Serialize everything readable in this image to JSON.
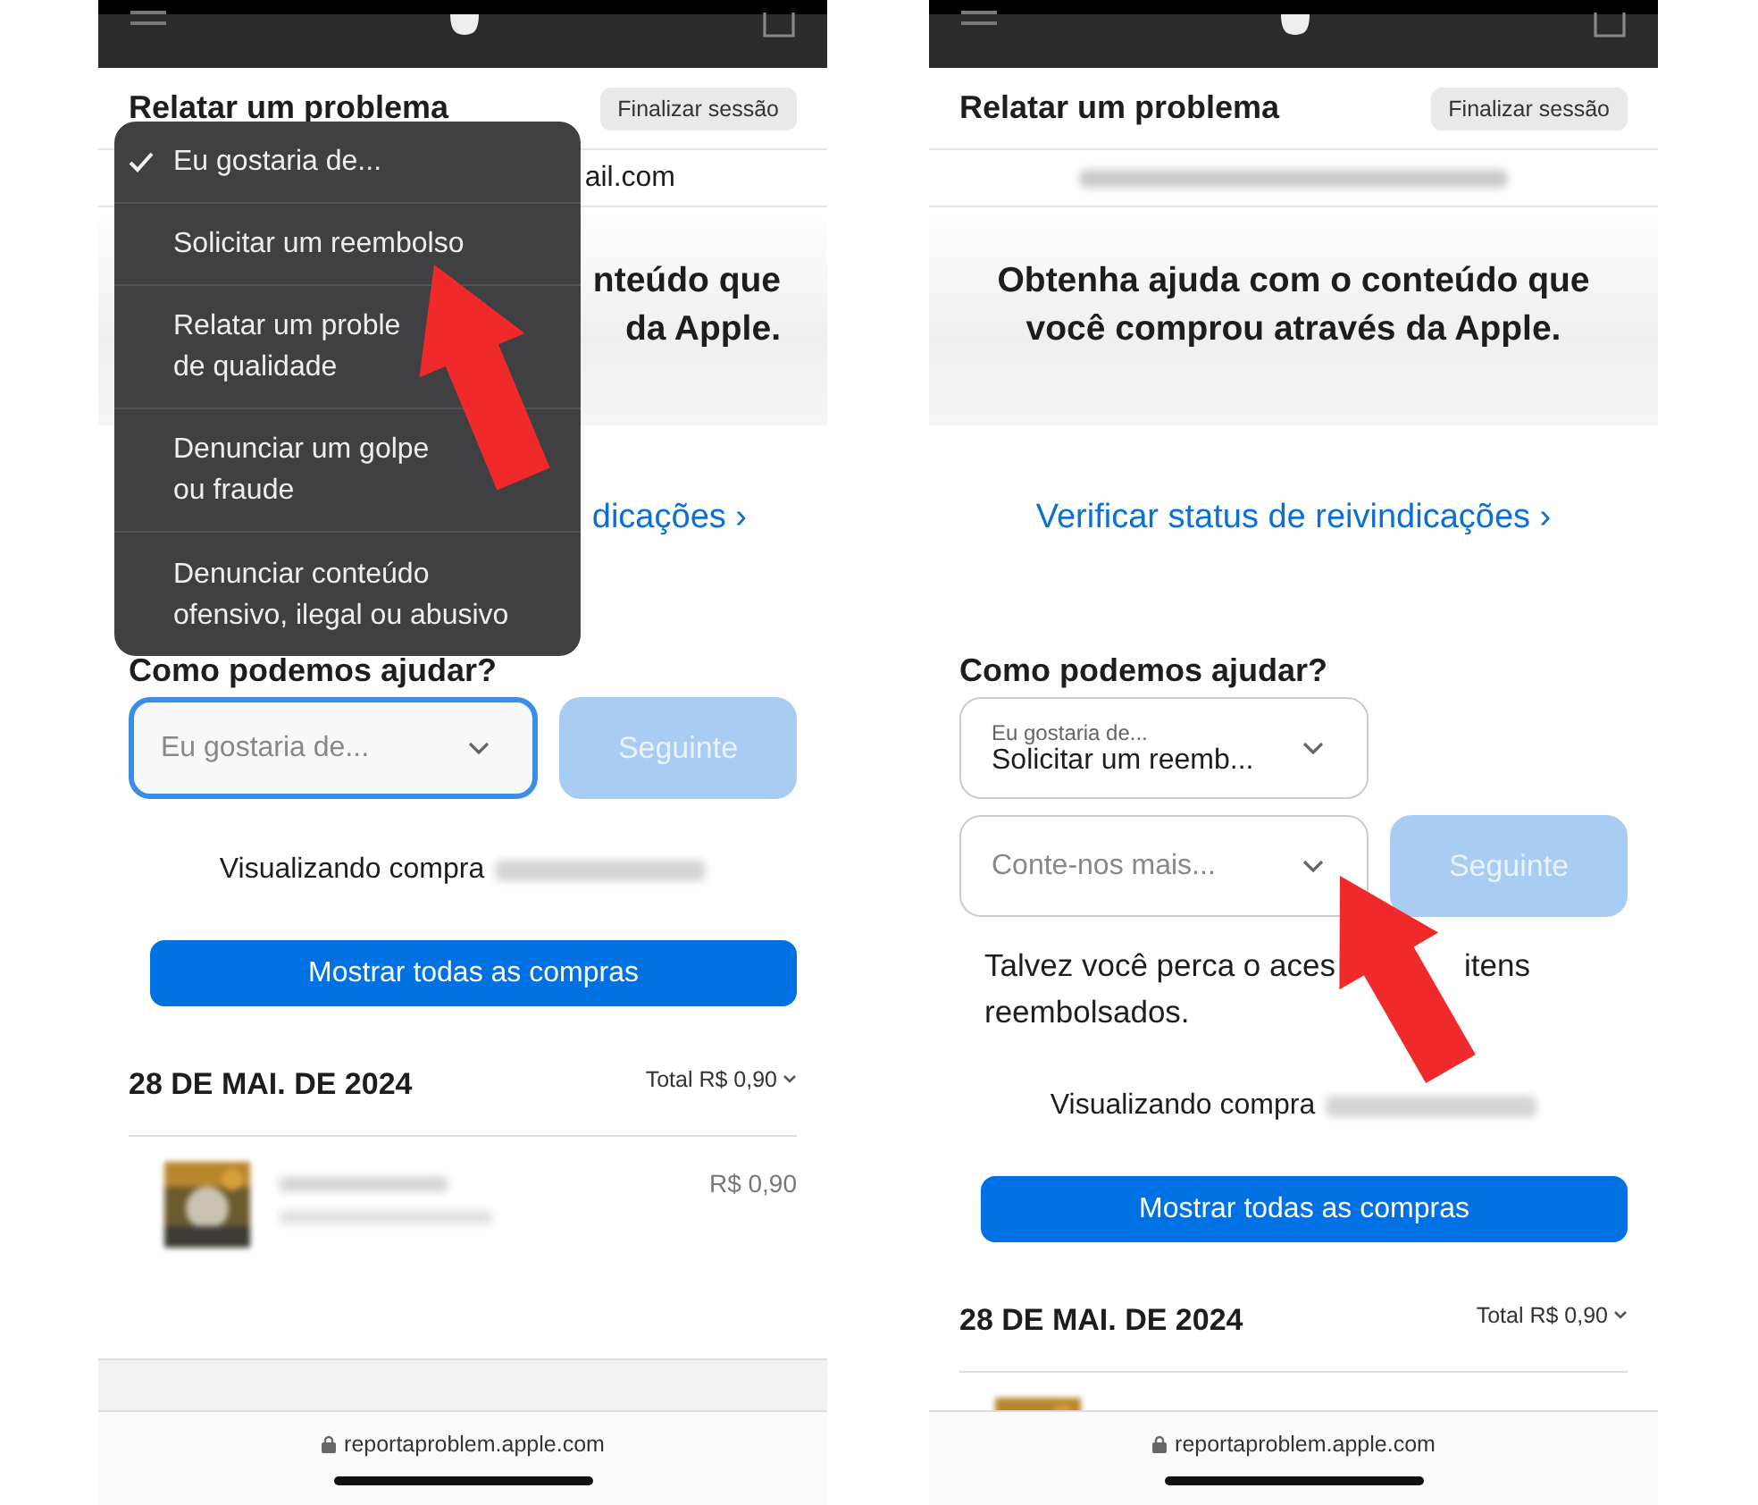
{
  "screens": [
    {
      "title": "Relatar um problema",
      "sign_out": "Finalizar sessão",
      "email": {
        "fragment": "ail.com"
      },
      "hero_lines": [
        "nteúdo que",
        "da Apple."
      ],
      "claims_link": "dicações ›",
      "help_heading": "Como podemos ajudar?",
      "selects": [
        {
          "kind": "placeholder",
          "placeholder": "Eu gostaria de...",
          "focused": true
        }
      ],
      "next_button": {
        "label": "Seguinte",
        "disabled": true
      },
      "viewing": "Visualizando compra",
      "show_all": "Mostrar todas as compras",
      "date": "28 DE MAI. DE 2024",
      "total": "Total R$ 0,90",
      "items": [
        {
          "kind": "purchase",
          "price": "R$ 0,90"
        }
      ],
      "url": "reportaproblem.apple.com",
      "menu": [
        {
          "lines": [
            "Eu gostaria de..."
          ],
          "selected": true
        },
        {
          "lines": [
            "Solicitar um reembolso"
          ],
          "selected": false
        },
        {
          "lines": [
            "Relatar um proble",
            "de qualidade"
          ],
          "selected": false
        },
        {
          "lines": [
            "Denunciar um golpe",
            "ou fraude"
          ],
          "selected": false
        },
        {
          "lines": [
            "Denunciar conteúdo",
            "ofensivo, ilegal ou abusivo"
          ],
          "selected": false
        }
      ],
      "arrow": {
        "kind": "menu"
      }
    },
    {
      "title": "Relatar um problema",
      "sign_out": "Finalizar sessão",
      "email": {
        "kind": "blurred"
      },
      "hero_lines": [
        "Obtenha ajuda com o conteúdo que",
        "você comprou através da Apple."
      ],
      "claims_link": "Verificar status de reivindicações ›",
      "help_heading": "Como podemos ajudar?",
      "selects": [
        {
          "kind": "filled",
          "label": "Eu gostaria de...",
          "value": "Solicitar um reemb...",
          "focused": false
        },
        {
          "kind": "placeholder",
          "placeholder": "Conte-nos mais...",
          "focused": false
        }
      ],
      "next_button": {
        "label": "Seguinte",
        "disabled": true
      },
      "notice": [
        [
          "Talvez você perca o aces",
          "itens"
        ],
        [
          "reembolsados."
        ]
      ],
      "viewing": "Visualizando compra",
      "show_all": "Mostrar todas as compras",
      "date": "28 DE MAI. DE 2024",
      "total": "Total R$ 0,90",
      "items": [
        {
          "kind": "picture"
        }
      ],
      "url": "reportaproblem.apple.com",
      "arrow": {
        "kind": "field"
      }
    }
  ]
}
